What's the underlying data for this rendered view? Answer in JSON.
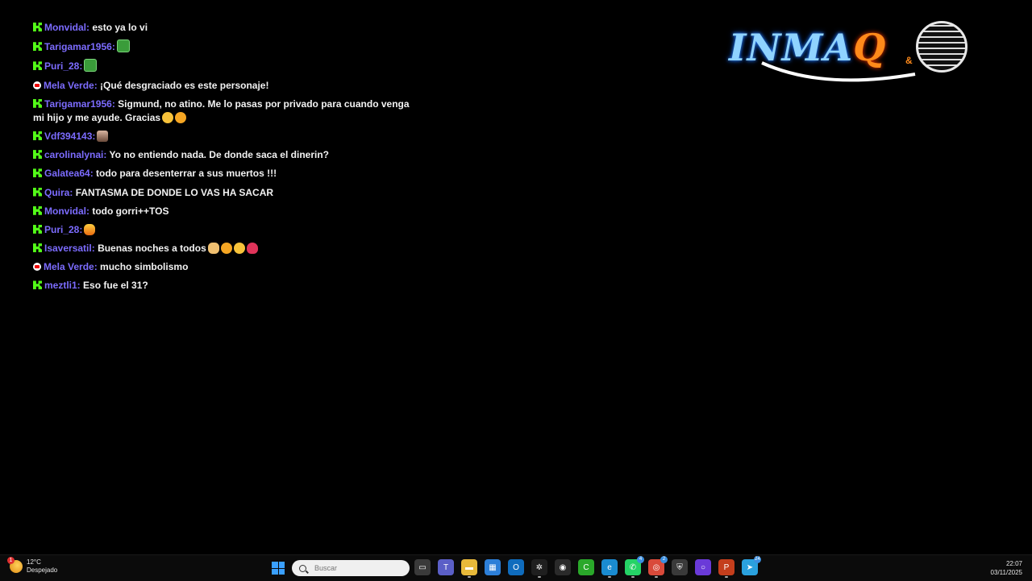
{
  "chat": {
    "messages": [
      {
        "platform": "kick",
        "user": "Monvidal:",
        "text": "esto ya lo vi",
        "emojis": []
      },
      {
        "platform": "kick",
        "user": "Tarigamar1956:",
        "text": "",
        "emojis": [
          "sticker"
        ]
      },
      {
        "platform": "kick",
        "user": "Puri_28:",
        "text": "",
        "emojis": [
          "sticker"
        ]
      },
      {
        "platform": "youtube",
        "user": "Mela Verde:",
        "text": "¡Qué desgraciado es este personaje!",
        "emojis": []
      },
      {
        "platform": "kick",
        "user": "Tarigamar1956:",
        "text": "Sigmund, no atino. Me lo pasas por privado para cuando venga mi hijo y me ayude. Gracias",
        "emojis": [
          "face",
          "kiss"
        ]
      },
      {
        "platform": "kick",
        "user": "Vdf394143:",
        "text": "",
        "emojis": [
          "photo"
        ]
      },
      {
        "platform": "kick",
        "user": "carolinalynai:",
        "text": "Yo no entiendo nada. De donde saca el dinerin?",
        "emojis": []
      },
      {
        "platform": "kick",
        "user": "Galatea64:",
        "text": "todo para desenterrar a sus muertos !!!",
        "emojis": []
      },
      {
        "platform": "kick",
        "user": "Quira:",
        "text": "FANTASMA DE DONDE LO VAS HA SACAR",
        "emojis": []
      },
      {
        "platform": "kick",
        "user": "Monvidal:",
        "text": "todo gorri++TOS",
        "emojis": []
      },
      {
        "platform": "kick",
        "user": "Puri_28:",
        "text": "",
        "emojis": [
          "fire"
        ]
      },
      {
        "platform": "kick",
        "user": "Isaversatil:",
        "text": "Buenas noches a todos",
        "emojis": [
          "hand",
          "kiss",
          "face",
          "heart"
        ]
      },
      {
        "platform": "youtube",
        "user": "Mela Verde:",
        "text": "mucho simbolismo",
        "emojis": []
      },
      {
        "platform": "kick",
        "user": "meztli1:",
        "text": "Eso fue el 31?",
        "emojis": []
      }
    ]
  },
  "logo": {
    "text_main": "INMA",
    "text_q": "Q",
    "amp": "&"
  },
  "taskbar": {
    "weather": {
      "temp": "12°C",
      "desc": "Despejado",
      "badge": "1"
    },
    "search_placeholder": "Buscar",
    "apps": [
      {
        "name": "task-view",
        "icon": "task-view-icon",
        "color": "#3a3a3a",
        "glyph": "▭",
        "badge": "",
        "running": false
      },
      {
        "name": "teams",
        "icon": "teams-icon",
        "color": "#5b5fc7",
        "glyph": "T",
        "badge": "",
        "running": false
      },
      {
        "name": "file-explorer",
        "icon": "folder-icon",
        "color": "#e8b93a",
        "glyph": "▬",
        "badge": "",
        "running": true
      },
      {
        "name": "store",
        "icon": "store-icon",
        "color": "#2d7fd8",
        "glyph": "▦",
        "badge": "",
        "running": false
      },
      {
        "name": "outlook",
        "icon": "outlook-icon",
        "color": "#0f6cbd",
        "glyph": "O",
        "badge": "",
        "running": false
      },
      {
        "name": "chatgpt",
        "icon": "openai-icon",
        "color": "#1f1f1f",
        "glyph": "✲",
        "badge": "",
        "running": true
      },
      {
        "name": "obs",
        "icon": "obs-icon",
        "color": "#2a2a2a",
        "glyph": "◉",
        "badge": "",
        "running": false
      },
      {
        "name": "camtasia",
        "icon": "camtasia-icon",
        "color": "#2aa82a",
        "glyph": "C",
        "badge": "",
        "running": false
      },
      {
        "name": "edge",
        "icon": "edge-icon",
        "color": "#1a8bd0",
        "glyph": "e",
        "badge": "",
        "running": true
      },
      {
        "name": "whatsapp",
        "icon": "whatsapp-icon",
        "color": "#25d366",
        "glyph": "✆",
        "badge": "4",
        "running": true
      },
      {
        "name": "chrome",
        "icon": "chrome-icon",
        "color": "#d94a3a",
        "glyph": "◎",
        "badge": "2",
        "running": true
      },
      {
        "name": "vpn",
        "icon": "shield-app-icon",
        "color": "#3a3a3a",
        "glyph": "⛨",
        "badge": "",
        "running": false
      },
      {
        "name": "circle-app",
        "icon": "circle-app-icon",
        "color": "#6a3ad8",
        "glyph": "○",
        "badge": "",
        "running": false
      },
      {
        "name": "powerpoint",
        "icon": "powerpoint-icon",
        "color": "#c43e1c",
        "glyph": "P",
        "badge": "",
        "running": true
      },
      {
        "name": "telegram",
        "icon": "telegram-icon",
        "color": "#2aa1de",
        "glyph": "➤",
        "badge": "24",
        "running": false
      }
    ],
    "clock": {
      "time": "22:07",
      "date": "03/11/2025"
    }
  }
}
